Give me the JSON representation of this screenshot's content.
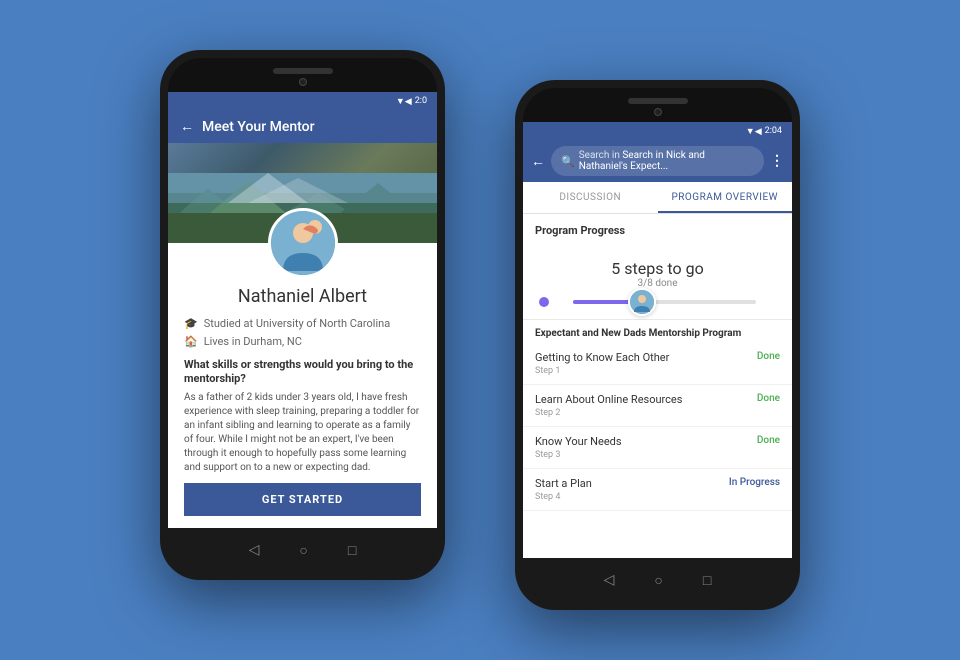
{
  "background": "#4a7fc1",
  "phone_left": {
    "status_bar": {
      "time": "2:0",
      "signal_icons": "▼◀"
    },
    "header": {
      "back_label": "←",
      "title": "Meet Your Mentor"
    },
    "profile": {
      "name": "Nathaniel Albert",
      "detail1": "Studied at University of North Carolina",
      "detail2": "Lives in Durham, NC",
      "question": "What skills or strengths would you bring to the mentorship?",
      "answer": "As a father of 2 kids under 3 years old, I have fresh experience with sleep training, preparing a toddler for an infant sibling and learning to operate as a family of four. While I might not be an expert, I've been through it enough to hopefully pass some learning and support on to a new or expecting dad.",
      "cta_label": "GET STARTED"
    },
    "nav": {
      "back": "◁",
      "home": "○",
      "recent": "□"
    }
  },
  "phone_right": {
    "status_bar": {
      "time": "2:04"
    },
    "header": {
      "back_label": "←",
      "search_placeholder": "Search in Nick and Nathaniel's Expect...",
      "menu_icon": "⋮"
    },
    "tabs": [
      {
        "label": "DISCUSSION",
        "active": false
      },
      {
        "label": "PROGRAM OVERVIEW",
        "active": true
      }
    ],
    "progress": {
      "section_title": "Program Progress",
      "steps_to_go": "5 steps to go",
      "done_text": "3/8 done"
    },
    "program": {
      "label": "Expectant and New Dads Mentorship Program",
      "steps": [
        {
          "name": "Getting to Know Each Other",
          "step": "Step 1",
          "status": "Done",
          "in_progress": false
        },
        {
          "name": "Learn About Online Resources",
          "step": "Step 2",
          "status": "Done",
          "in_progress": false
        },
        {
          "name": "Know Your Needs",
          "step": "Step 3",
          "status": "Done",
          "in_progress": false
        },
        {
          "name": "Start a Plan",
          "step": "Step 4",
          "status": "In Progress",
          "in_progress": true
        }
      ]
    },
    "nav": {
      "back": "◁",
      "home": "○",
      "recent": "□"
    }
  }
}
